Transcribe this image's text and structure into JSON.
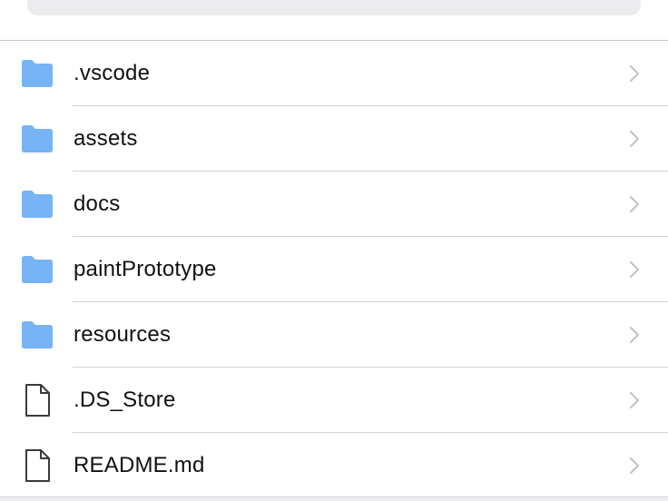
{
  "search": {
    "placeholder": "",
    "icon": "search-icon"
  },
  "colors": {
    "folder": "#76b4f5",
    "file_outline": "#3a3a3c",
    "chevron": "#c4c4c7",
    "separator": "#d1d1d6"
  },
  "files": [
    {
      "name": ".vscode",
      "type": "folder",
      "icon": "folder-icon"
    },
    {
      "name": "assets",
      "type": "folder",
      "icon": "folder-icon"
    },
    {
      "name": "docs",
      "type": "folder",
      "icon": "folder-icon"
    },
    {
      "name": "paintPrototype",
      "type": "folder",
      "icon": "folder-icon"
    },
    {
      "name": "resources",
      "type": "folder",
      "icon": "folder-icon"
    },
    {
      "name": ".DS_Store",
      "type": "file",
      "icon": "document-icon"
    },
    {
      "name": "README.md",
      "type": "file",
      "icon": "document-icon"
    }
  ]
}
